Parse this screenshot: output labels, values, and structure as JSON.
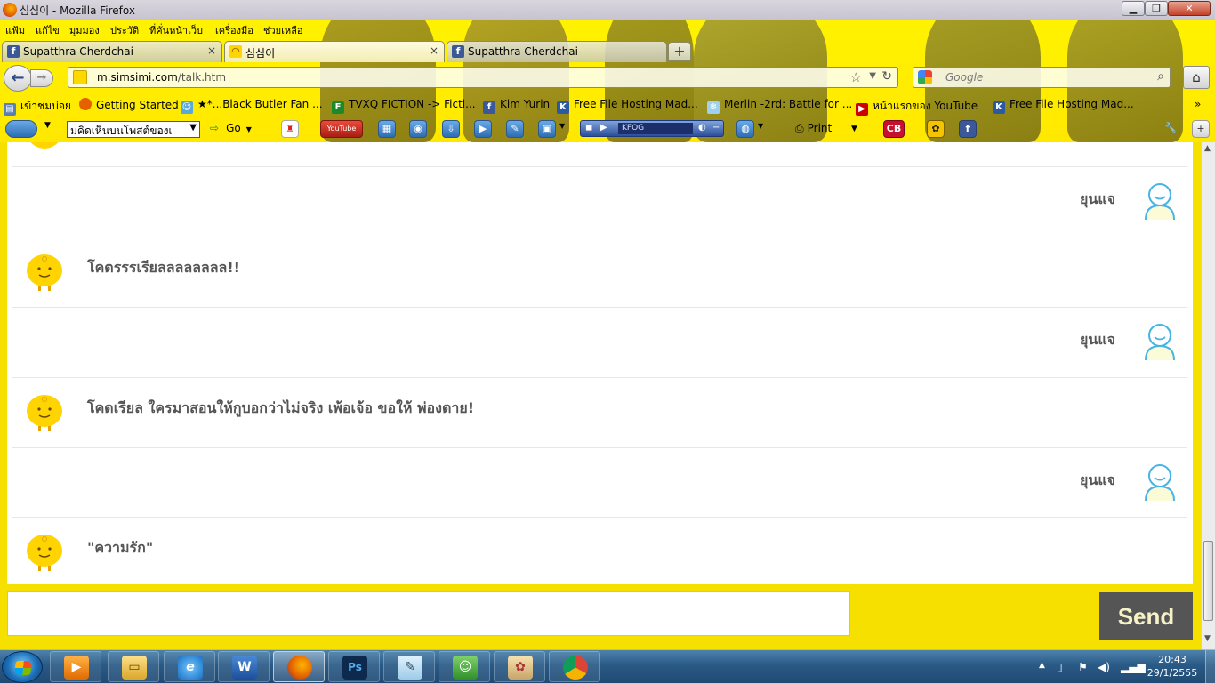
{
  "window": {
    "title": "심심이 - Mozilla Firefox",
    "min_label": "▁",
    "max_label": "❐",
    "close_label": "✕"
  },
  "menu": [
    "แฟ้ม",
    "แก้ไข",
    "มุมมอง",
    "ประวัติ",
    "ที่คั่นหน้าเว็บ",
    "เครื่องมือ",
    "ช่วยเหลือ"
  ],
  "tabs": [
    {
      "label": "Supatthra Cherdchai",
      "icon": "facebook-icon",
      "active": false
    },
    {
      "label": "심심이",
      "icon": "simsimi-icon",
      "active": true
    },
    {
      "label": "Supatthra Cherdchai",
      "icon": "facebook-icon",
      "active": false
    }
  ],
  "tab_close": "×",
  "new_tab": "+",
  "nav": {
    "back": "←",
    "forward": "→",
    "url_prefix": "m.simsimi.com",
    "url_path": "/talk.htm",
    "search_placeholder": "Google",
    "home": "⌂"
  },
  "bookmarks": [
    "เข้าชมบ่อย",
    "Getting Started",
    "★*...Black Butler Fan ...",
    "TVXQ FICTION -> Ficti...",
    "Kim Yurin",
    "Free File Hosting Mad...",
    "Merlin -2rd: Battle for ...",
    "หน้าแรกของ YouTube",
    "Free File Hosting Mad..."
  ],
  "bookmarks_more": "»",
  "toolbar2": {
    "select_value": "มคิดเห็นบนโพสต์ของเ",
    "go_label": "Go",
    "youtube_label": "YouTube",
    "radio_station": "KFOG",
    "print_label": "Print",
    "cb_label": "CB"
  },
  "chat": [
    {
      "from": "user",
      "name": "ยุนแจ"
    },
    {
      "from": "simsimi",
      "text": "โคตรรรเรียลลลลลลลล!!"
    },
    {
      "from": "user",
      "name": "ยุนแจ"
    },
    {
      "from": "simsimi",
      "text": "โคดเรียล ใครมาสอนให้กูบอกว่าไม่จริง เพ้อเจ้อ ขอให้ พ่องตาย!"
    },
    {
      "from": "user",
      "name": "ยุนแจ"
    },
    {
      "from": "simsimi",
      "text": "\"ความรัก\""
    }
  ],
  "input": {
    "value": ""
  },
  "send_label": "Send",
  "taskbar": {
    "apps": [
      "windows-media-player",
      "file-explorer",
      "internet-explorer",
      "microsoft-word",
      "firefox",
      "photoshop",
      "notepad",
      "live-messenger",
      "paint",
      "chrome"
    ],
    "time": "20:43",
    "date": "29/1/2555"
  },
  "colors": {
    "page_bg": "#f5e000",
    "send_bg": "#555555",
    "message_text": "#555555",
    "simsimi_yellow": "#ffd400",
    "user_avatar": "#45b4e6"
  }
}
